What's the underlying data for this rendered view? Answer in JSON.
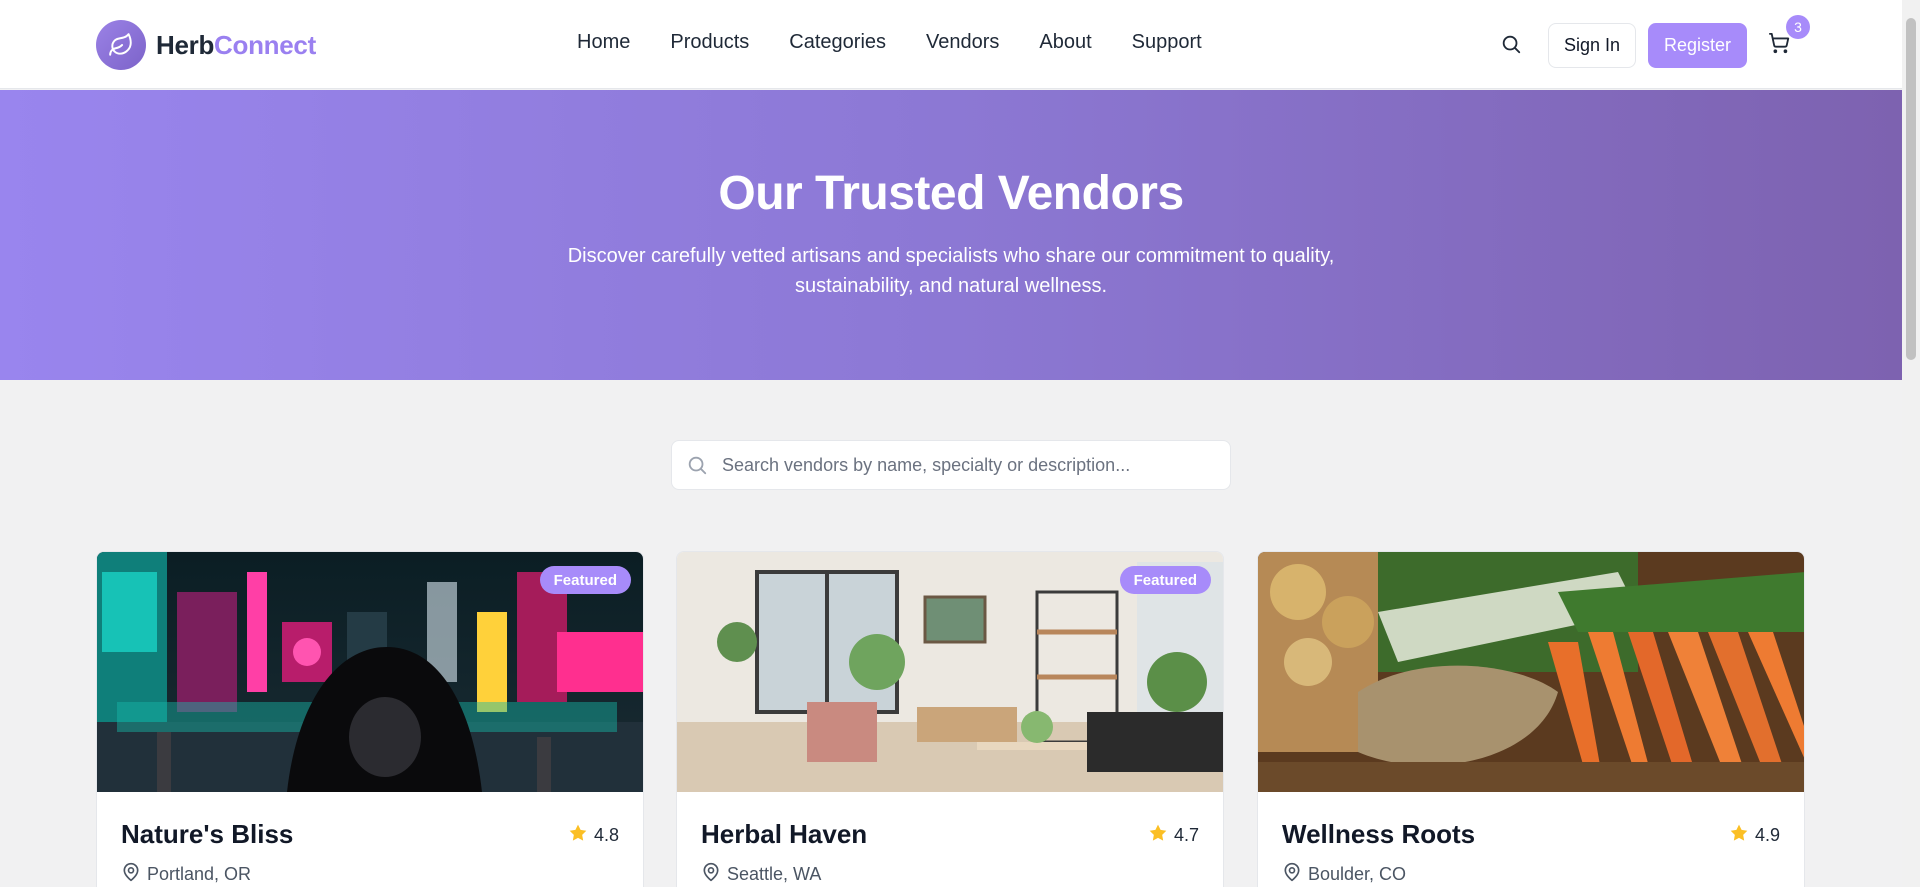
{
  "brand": {
    "part1": "Herb",
    "part2": "Connect"
  },
  "nav": [
    {
      "label": "Home"
    },
    {
      "label": "Products"
    },
    {
      "label": "Categories"
    },
    {
      "label": "Vendors"
    },
    {
      "label": "About"
    },
    {
      "label": "Support"
    }
  ],
  "header": {
    "sign_in": "Sign In",
    "register": "Register",
    "cart_count": "3"
  },
  "hero": {
    "title": "Our Trusted Vendors",
    "subtitle": "Discover carefully vetted artisans and specialists who share our commitment to quality, sustainability, and natural wellness."
  },
  "search": {
    "placeholder": "Search vendors by name, specialty or description...",
    "value": ""
  },
  "vendors": [
    {
      "name": "Nature's Bliss",
      "rating": "4.8",
      "location": "Portland, OR",
      "badge": "Featured",
      "image": "neon-street-night-photo"
    },
    {
      "name": "Herbal Haven",
      "rating": "4.7",
      "location": "Seattle, WA",
      "badge": "Featured",
      "image": "living-room-interior-photo"
    },
    {
      "name": "Wellness Roots",
      "rating": "4.9",
      "location": "Boulder, CO",
      "badge": "",
      "image": "vegetables-onions-carrots-photo"
    }
  ],
  "colors": {
    "accent": "#a78bfa",
    "brand_text": "#9a80f0",
    "hero_start": "#9985ee",
    "hero_end": "#7d62b0",
    "star": "#fbbf24"
  }
}
